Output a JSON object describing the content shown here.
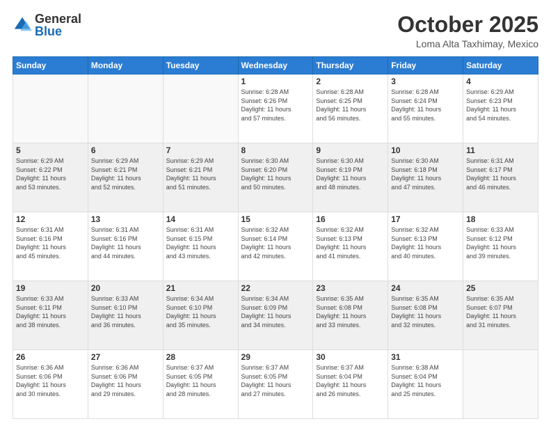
{
  "logo": {
    "general": "General",
    "blue": "Blue"
  },
  "header": {
    "title": "October 2025",
    "subtitle": "Loma Alta Taxhimay, Mexico"
  },
  "days_of_week": [
    "Sunday",
    "Monday",
    "Tuesday",
    "Wednesday",
    "Thursday",
    "Friday",
    "Saturday"
  ],
  "weeks": [
    [
      {
        "day": "",
        "info": ""
      },
      {
        "day": "",
        "info": ""
      },
      {
        "day": "",
        "info": ""
      },
      {
        "day": "1",
        "info": "Sunrise: 6:28 AM\nSunset: 6:26 PM\nDaylight: 11 hours\nand 57 minutes."
      },
      {
        "day": "2",
        "info": "Sunrise: 6:28 AM\nSunset: 6:25 PM\nDaylight: 11 hours\nand 56 minutes."
      },
      {
        "day": "3",
        "info": "Sunrise: 6:28 AM\nSunset: 6:24 PM\nDaylight: 11 hours\nand 55 minutes."
      },
      {
        "day": "4",
        "info": "Sunrise: 6:29 AM\nSunset: 6:23 PM\nDaylight: 11 hours\nand 54 minutes."
      }
    ],
    [
      {
        "day": "5",
        "info": "Sunrise: 6:29 AM\nSunset: 6:22 PM\nDaylight: 11 hours\nand 53 minutes."
      },
      {
        "day": "6",
        "info": "Sunrise: 6:29 AM\nSunset: 6:21 PM\nDaylight: 11 hours\nand 52 minutes."
      },
      {
        "day": "7",
        "info": "Sunrise: 6:29 AM\nSunset: 6:21 PM\nDaylight: 11 hours\nand 51 minutes."
      },
      {
        "day": "8",
        "info": "Sunrise: 6:30 AM\nSunset: 6:20 PM\nDaylight: 11 hours\nand 50 minutes."
      },
      {
        "day": "9",
        "info": "Sunrise: 6:30 AM\nSunset: 6:19 PM\nDaylight: 11 hours\nand 48 minutes."
      },
      {
        "day": "10",
        "info": "Sunrise: 6:30 AM\nSunset: 6:18 PM\nDaylight: 11 hours\nand 47 minutes."
      },
      {
        "day": "11",
        "info": "Sunrise: 6:31 AM\nSunset: 6:17 PM\nDaylight: 11 hours\nand 46 minutes."
      }
    ],
    [
      {
        "day": "12",
        "info": "Sunrise: 6:31 AM\nSunset: 6:16 PM\nDaylight: 11 hours\nand 45 minutes."
      },
      {
        "day": "13",
        "info": "Sunrise: 6:31 AM\nSunset: 6:16 PM\nDaylight: 11 hours\nand 44 minutes."
      },
      {
        "day": "14",
        "info": "Sunrise: 6:31 AM\nSunset: 6:15 PM\nDaylight: 11 hours\nand 43 minutes."
      },
      {
        "day": "15",
        "info": "Sunrise: 6:32 AM\nSunset: 6:14 PM\nDaylight: 11 hours\nand 42 minutes."
      },
      {
        "day": "16",
        "info": "Sunrise: 6:32 AM\nSunset: 6:13 PM\nDaylight: 11 hours\nand 41 minutes."
      },
      {
        "day": "17",
        "info": "Sunrise: 6:32 AM\nSunset: 6:13 PM\nDaylight: 11 hours\nand 40 minutes."
      },
      {
        "day": "18",
        "info": "Sunrise: 6:33 AM\nSunset: 6:12 PM\nDaylight: 11 hours\nand 39 minutes."
      }
    ],
    [
      {
        "day": "19",
        "info": "Sunrise: 6:33 AM\nSunset: 6:11 PM\nDaylight: 11 hours\nand 38 minutes."
      },
      {
        "day": "20",
        "info": "Sunrise: 6:33 AM\nSunset: 6:10 PM\nDaylight: 11 hours\nand 36 minutes."
      },
      {
        "day": "21",
        "info": "Sunrise: 6:34 AM\nSunset: 6:10 PM\nDaylight: 11 hours\nand 35 minutes."
      },
      {
        "day": "22",
        "info": "Sunrise: 6:34 AM\nSunset: 6:09 PM\nDaylight: 11 hours\nand 34 minutes."
      },
      {
        "day": "23",
        "info": "Sunrise: 6:35 AM\nSunset: 6:08 PM\nDaylight: 11 hours\nand 33 minutes."
      },
      {
        "day": "24",
        "info": "Sunrise: 6:35 AM\nSunset: 6:08 PM\nDaylight: 11 hours\nand 32 minutes."
      },
      {
        "day": "25",
        "info": "Sunrise: 6:35 AM\nSunset: 6:07 PM\nDaylight: 11 hours\nand 31 minutes."
      }
    ],
    [
      {
        "day": "26",
        "info": "Sunrise: 6:36 AM\nSunset: 6:06 PM\nDaylight: 11 hours\nand 30 minutes."
      },
      {
        "day": "27",
        "info": "Sunrise: 6:36 AM\nSunset: 6:06 PM\nDaylight: 11 hours\nand 29 minutes."
      },
      {
        "day": "28",
        "info": "Sunrise: 6:37 AM\nSunset: 6:05 PM\nDaylight: 11 hours\nand 28 minutes."
      },
      {
        "day": "29",
        "info": "Sunrise: 6:37 AM\nSunset: 6:05 PM\nDaylight: 11 hours\nand 27 minutes."
      },
      {
        "day": "30",
        "info": "Sunrise: 6:37 AM\nSunset: 6:04 PM\nDaylight: 11 hours\nand 26 minutes."
      },
      {
        "day": "31",
        "info": "Sunrise: 6:38 AM\nSunset: 6:04 PM\nDaylight: 11 hours\nand 25 minutes."
      },
      {
        "day": "",
        "info": ""
      }
    ]
  ]
}
